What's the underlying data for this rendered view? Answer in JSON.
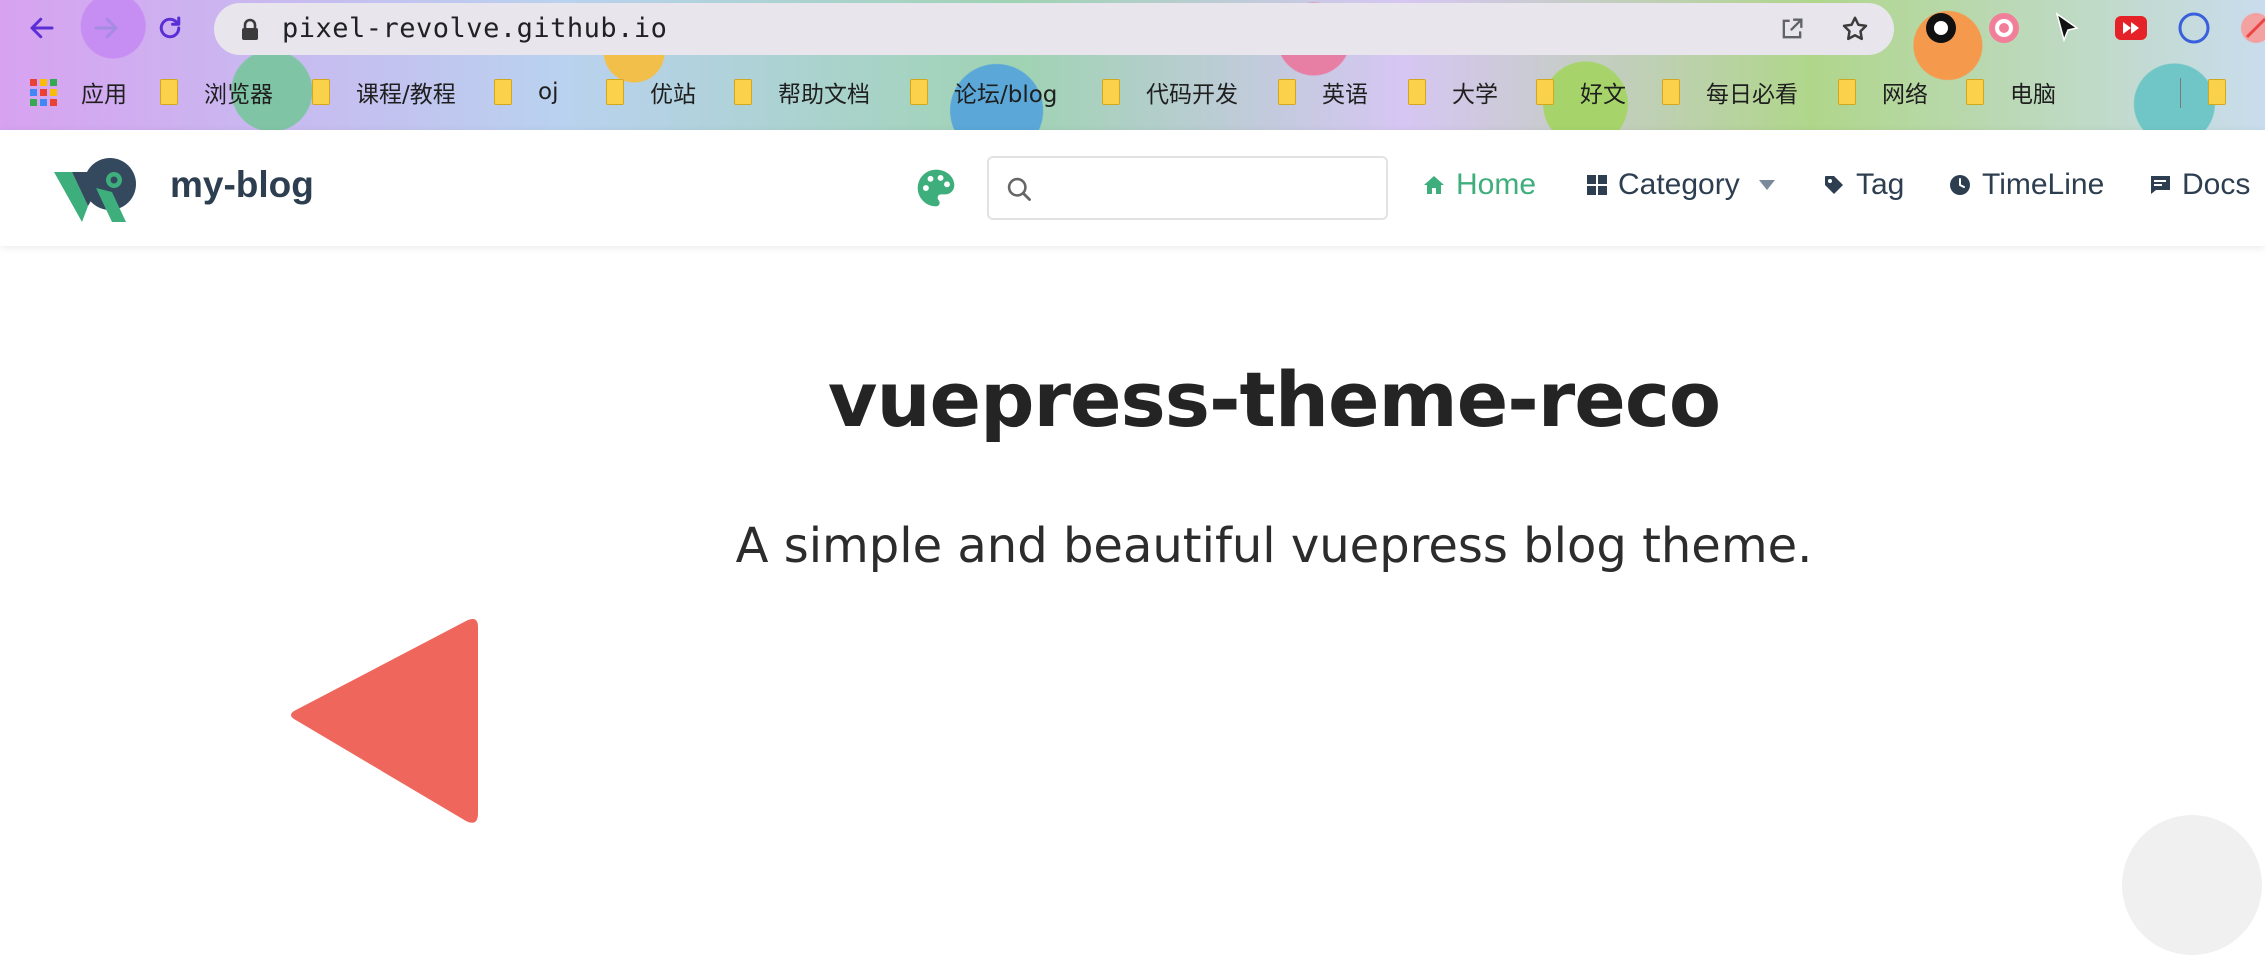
{
  "browser": {
    "url": "pixel-revolve.github.io",
    "bookmarks": [
      {
        "label": "应用",
        "type": "apps"
      },
      {
        "label": "浏览器",
        "type": "folder"
      },
      {
        "label": "课程/教程",
        "type": "folder"
      },
      {
        "label": "oj",
        "type": "folder"
      },
      {
        "label": "优站",
        "type": "folder"
      },
      {
        "label": "帮助文档",
        "type": "folder"
      },
      {
        "label": "论坛/blog",
        "type": "folder"
      },
      {
        "label": "代码开发",
        "type": "folder"
      },
      {
        "label": "英语",
        "type": "folder"
      },
      {
        "label": "大学",
        "type": "folder"
      },
      {
        "label": "好文",
        "type": "folder"
      },
      {
        "label": "每日必看",
        "type": "folder"
      },
      {
        "label": "网络",
        "type": "folder"
      },
      {
        "label": "电脑",
        "type": "folder"
      }
    ]
  },
  "site": {
    "name": "my-blog",
    "search_placeholder": "",
    "nav": [
      {
        "label": "Home",
        "icon": "home-icon",
        "active": true
      },
      {
        "label": "Category",
        "icon": "category-icon",
        "active": false,
        "dropdown": true
      },
      {
        "label": "Tag",
        "icon": "tag-icon",
        "active": false
      },
      {
        "label": "TimeLine",
        "icon": "clock-icon",
        "active": false
      },
      {
        "label": "Docs",
        "icon": "docs-icon",
        "active": false
      }
    ]
  },
  "hero": {
    "title": "vuepress-theme-reco",
    "subtitle": "A simple and beautiful vuepress blog theme."
  },
  "colors": {
    "accent": "#3eaf7c",
    "triangle": "#ef675c",
    "text": "#2c3e50"
  }
}
